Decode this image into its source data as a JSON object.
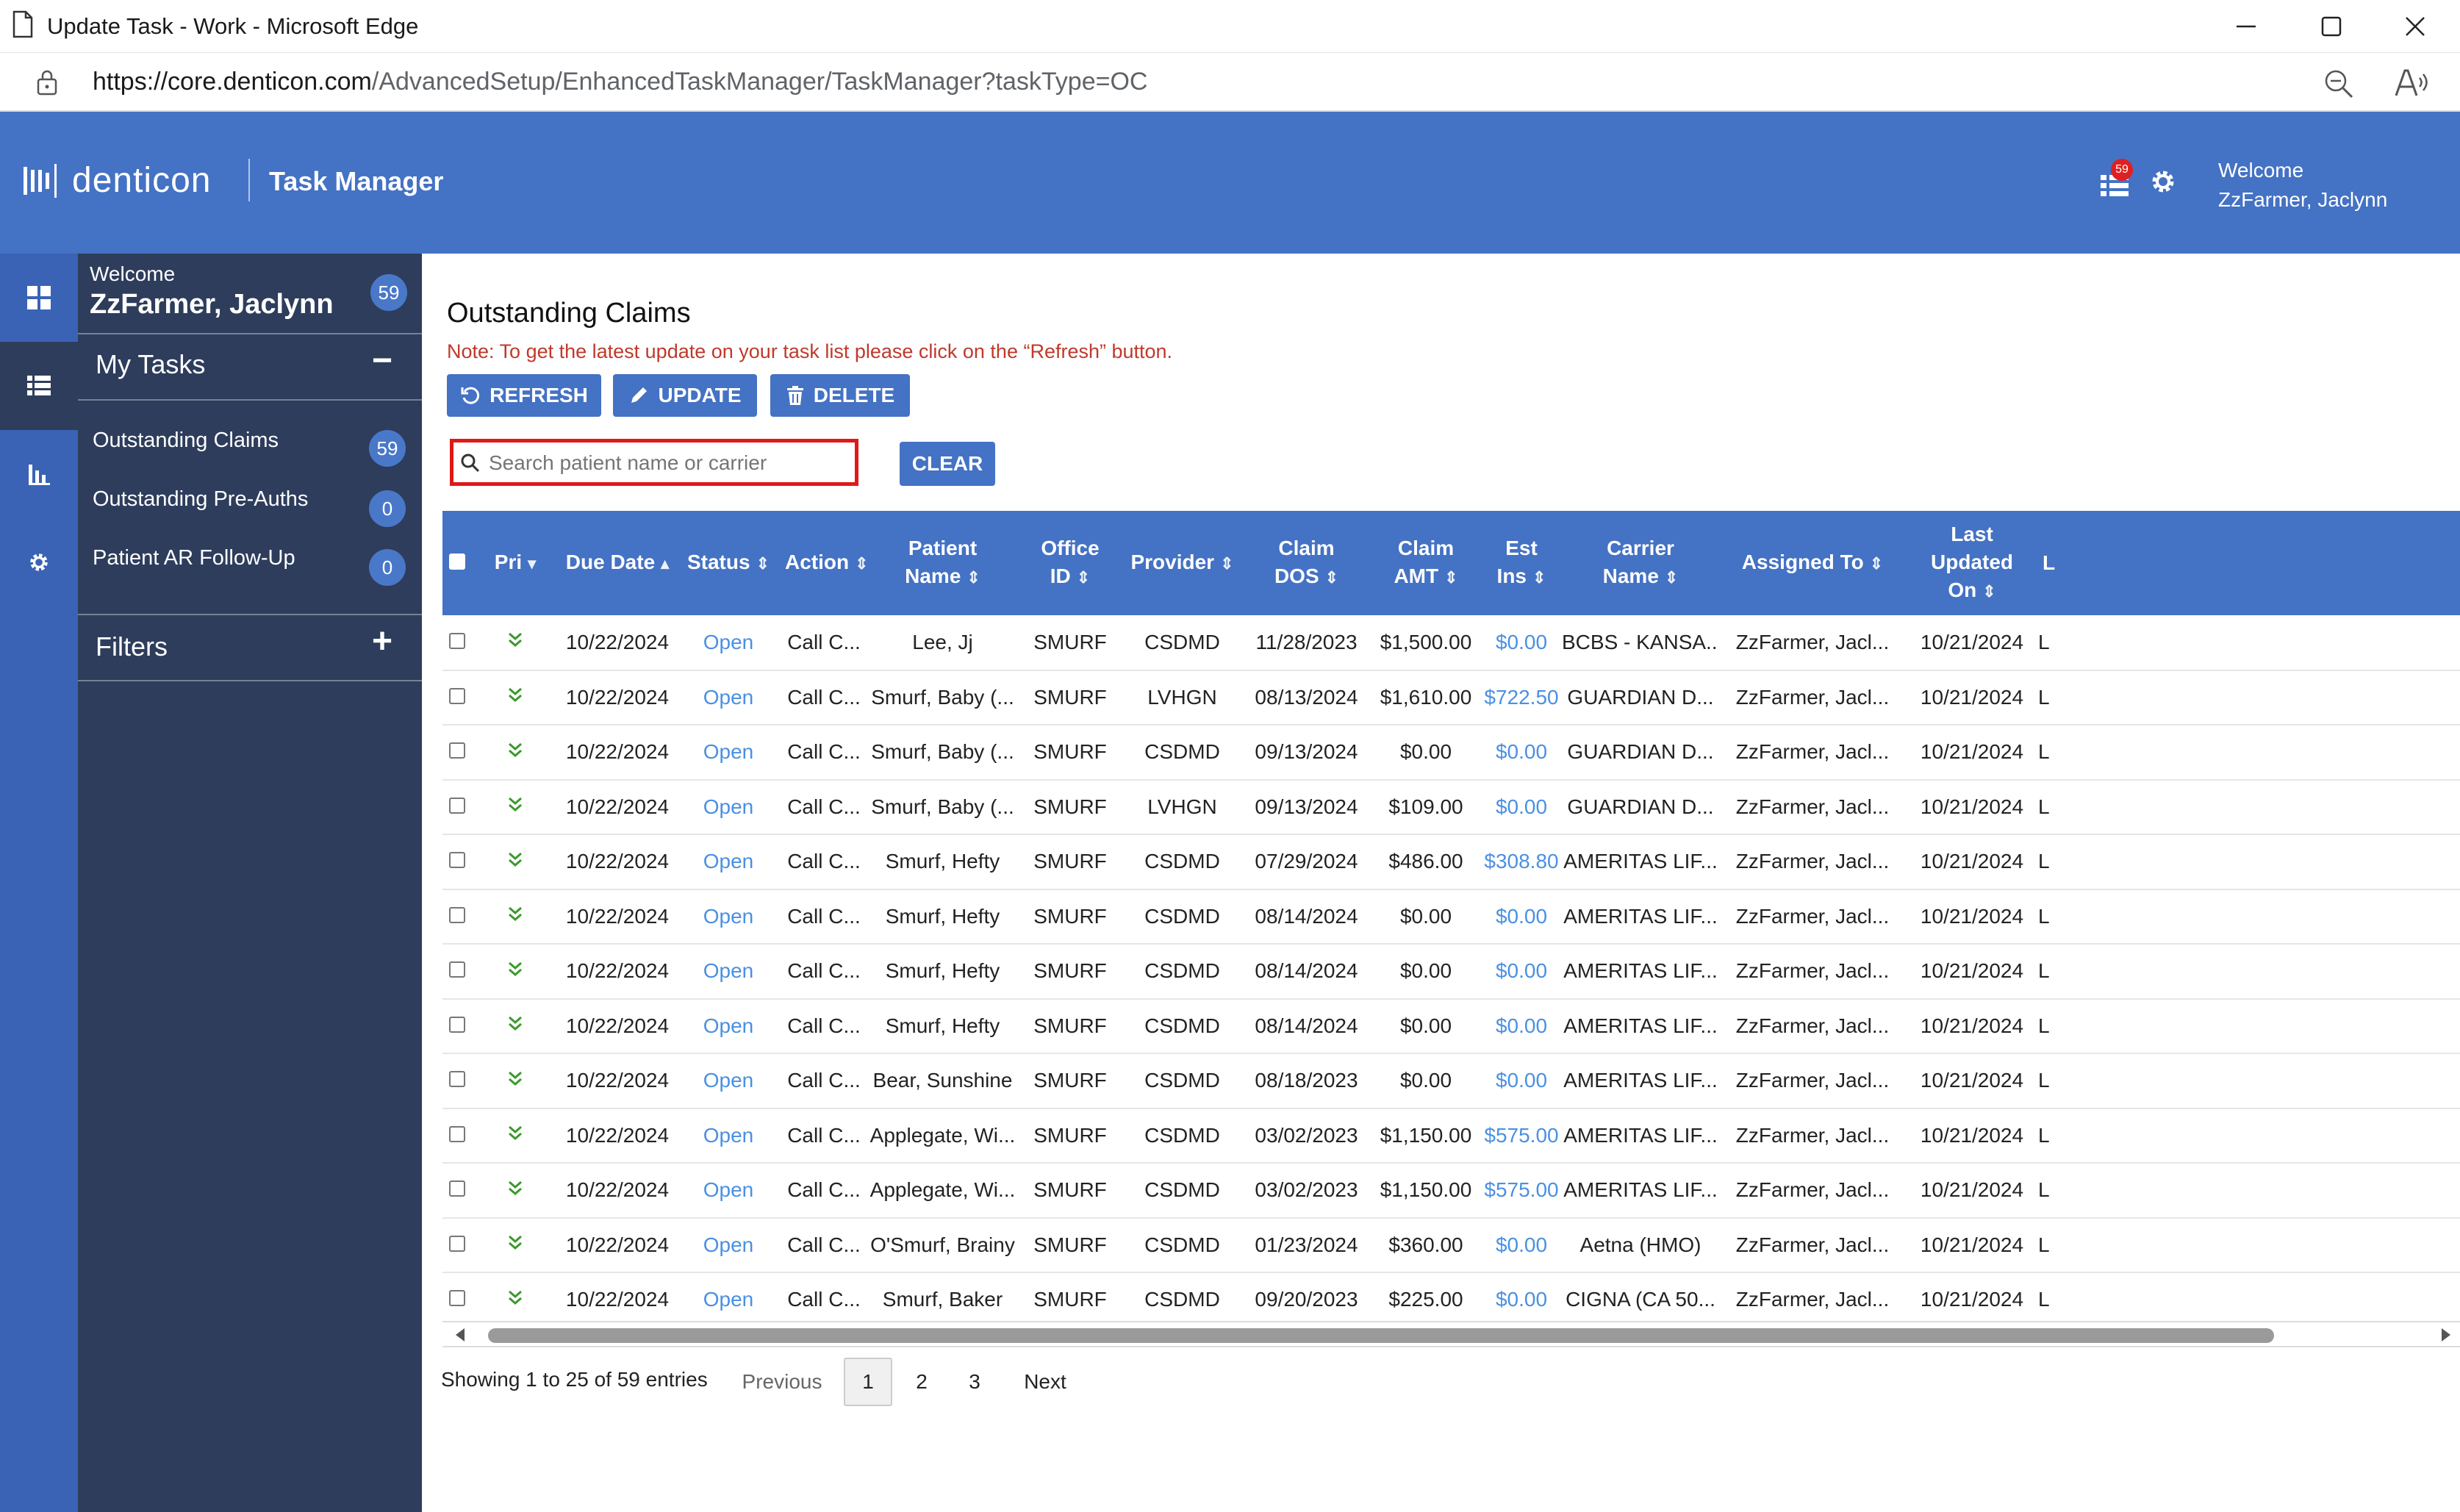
{
  "window": {
    "title": "Update Task - Work - Microsoft Edge"
  },
  "address": {
    "url_host": "https://core.denticon.com",
    "url_path": "/AdvancedSetup/EnhancedTaskManager/TaskManager?taskType=OC"
  },
  "header": {
    "brand": "denticon",
    "app": "Task Manager",
    "notification_count": "59",
    "welcome": "Welcome",
    "user": "ZzFarmer, Jaclynn"
  },
  "sidebar": {
    "welcome": "Welcome",
    "user": "ZzFarmer, Jaclynn",
    "count": "59",
    "my_tasks": "My Tasks",
    "items": [
      {
        "label": "Outstanding Claims",
        "count": "59"
      },
      {
        "label": "Outstanding Pre-Auths",
        "count": "0"
      },
      {
        "label": "Patient AR Follow-Up",
        "count": "0"
      }
    ],
    "filters": "Filters"
  },
  "main": {
    "title": "Outstanding Claims",
    "note": "Note: To get the latest update on your task list please click on the “Refresh” button.",
    "refresh": "REFRESH",
    "update": "UPDATE",
    "delete": "DELETE",
    "search_placeholder": "Search patient name or carrier",
    "clear": "CLEAR"
  },
  "table": {
    "columns": [
      "Pri",
      "Due Date",
      "Status",
      "Action",
      "Patient Name",
      "Office ID",
      "Provider",
      "Claim DOS",
      "Claim AMT",
      "Est Ins",
      "Carrier Name",
      "Assigned To",
      "Last Updated On",
      "L"
    ],
    "rows": [
      [
        "10/22/2024",
        "Open",
        "Call C...",
        "Lee, Jj",
        "SMURF",
        "CSDMD",
        "11/28/2023",
        "$1,500.00",
        "$0.00",
        "BCBS - KANSA...",
        "ZzFarmer, Jacl...",
        "10/21/2024",
        "L"
      ],
      [
        "10/22/2024",
        "Open",
        "Call C...",
        "Smurf, Baby (...",
        "SMURF",
        "LVHGN",
        "08/13/2024",
        "$1,610.00",
        "$722.50",
        "GUARDIAN D...",
        "ZzFarmer, Jacl...",
        "10/21/2024",
        "L"
      ],
      [
        "10/22/2024",
        "Open",
        "Call C...",
        "Smurf, Baby (...",
        "SMURF",
        "CSDMD",
        "09/13/2024",
        "$0.00",
        "$0.00",
        "GUARDIAN D...",
        "ZzFarmer, Jacl...",
        "10/21/2024",
        "L"
      ],
      [
        "10/22/2024",
        "Open",
        "Call C...",
        "Smurf, Baby (...",
        "SMURF",
        "LVHGN",
        "09/13/2024",
        "$109.00",
        "$0.00",
        "GUARDIAN D...",
        "ZzFarmer, Jacl...",
        "10/21/2024",
        "L"
      ],
      [
        "10/22/2024",
        "Open",
        "Call C...",
        "Smurf, Hefty",
        "SMURF",
        "CSDMD",
        "07/29/2024",
        "$486.00",
        "$308.80",
        "AMERITAS LIF...",
        "ZzFarmer, Jacl...",
        "10/21/2024",
        "L"
      ],
      [
        "10/22/2024",
        "Open",
        "Call C...",
        "Smurf, Hefty",
        "SMURF",
        "CSDMD",
        "08/14/2024",
        "$0.00",
        "$0.00",
        "AMERITAS LIF...",
        "ZzFarmer, Jacl...",
        "10/21/2024",
        "L"
      ],
      [
        "10/22/2024",
        "Open",
        "Call C...",
        "Smurf, Hefty",
        "SMURF",
        "CSDMD",
        "08/14/2024",
        "$0.00",
        "$0.00",
        "AMERITAS LIF...",
        "ZzFarmer, Jacl...",
        "10/21/2024",
        "L"
      ],
      [
        "10/22/2024",
        "Open",
        "Call C...",
        "Smurf, Hefty",
        "SMURF",
        "CSDMD",
        "08/14/2024",
        "$0.00",
        "$0.00",
        "AMERITAS LIF...",
        "ZzFarmer, Jacl...",
        "10/21/2024",
        "L"
      ],
      [
        "10/22/2024",
        "Open",
        "Call C...",
        "Bear, Sunshine",
        "SMURF",
        "CSDMD",
        "08/18/2023",
        "$0.00",
        "$0.00",
        "AMERITAS LIF...",
        "ZzFarmer, Jacl...",
        "10/21/2024",
        "L"
      ],
      [
        "10/22/2024",
        "Open",
        "Call C...",
        "Applegate, Wi...",
        "SMURF",
        "CSDMD",
        "03/02/2023",
        "$1,150.00",
        "$575.00",
        "AMERITAS LIF...",
        "ZzFarmer, Jacl...",
        "10/21/2024",
        "L"
      ],
      [
        "10/22/2024",
        "Open",
        "Call C...",
        "Applegate, Wi...",
        "SMURF",
        "CSDMD",
        "03/02/2023",
        "$1,150.00",
        "$575.00",
        "AMERITAS LIF...",
        "ZzFarmer, Jacl...",
        "10/21/2024",
        "L"
      ],
      [
        "10/22/2024",
        "Open",
        "Call C...",
        "O'Smurf, Brainy",
        "SMURF",
        "CSDMD",
        "01/23/2024",
        "$360.00",
        "$0.00",
        "Aetna (HMO)",
        "ZzFarmer, Jacl...",
        "10/21/2024",
        "L"
      ],
      [
        "10/22/2024",
        "Open",
        "Call C...",
        "Smurf, Baker",
        "SMURF",
        "CSDMD",
        "09/20/2023",
        "$225.00",
        "$0.00",
        "CIGNA (CA 50...",
        "ZzFarmer, Jacl...",
        "10/21/2024",
        "L"
      ]
    ]
  },
  "footer": {
    "info": "Showing 1 to 25 of 59 entries",
    "previous": "Previous",
    "pages": [
      "1",
      "2",
      "3"
    ],
    "next": "Next"
  },
  "colors": {
    "brand_blue": "#4472c4",
    "sidebar": "#2e3d5c",
    "link": "#4a90e2",
    "note_red": "#c0392b",
    "priority_green": "#3a9a2a"
  }
}
